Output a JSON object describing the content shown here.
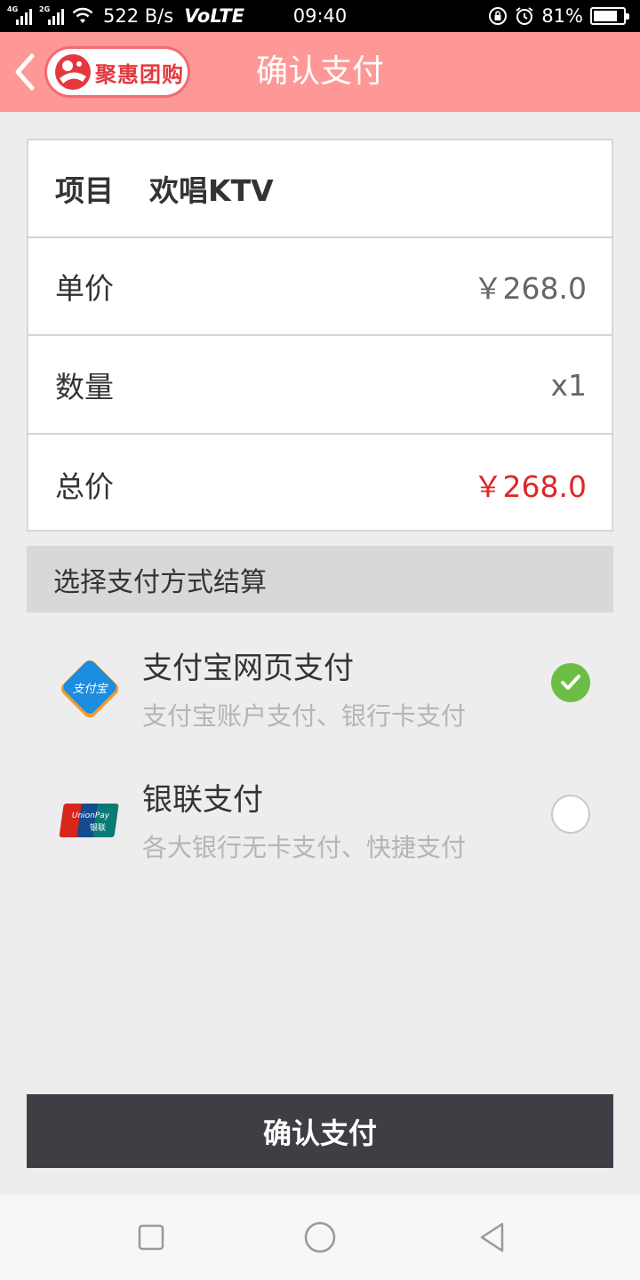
{
  "status_bar": {
    "network_1": "4G",
    "network_2": "2G",
    "speed": "522 B/s",
    "volte": "VoLTE",
    "time": "09:40",
    "battery": "81%",
    "battery_level": 0.81
  },
  "header": {
    "title": "确认支付",
    "logo_text": "聚惠团购"
  },
  "order": {
    "item_label": "项目",
    "item_value": "欢唱KTV",
    "unit_price_label": "单价",
    "unit_price_value": "￥268.0",
    "quantity_label": "数量",
    "quantity_value": "x1",
    "total_label": "总价",
    "total_value": "￥268.0"
  },
  "payment": {
    "section_title": "选择支付方式结算",
    "options": [
      {
        "name": "支付宝网页支付",
        "desc": "支付宝账户支付、银行卡支付",
        "selected": true,
        "icon": "alipay-icon",
        "icon_text": "支付宝"
      },
      {
        "name": "银联支付",
        "desc": "各大银行无卡支付、快捷支付",
        "selected": false,
        "icon": "unionpay-icon",
        "icon_text_1": "UnionPay",
        "icon_text_2": "银联"
      }
    ]
  },
  "confirm_button": "确认支付",
  "colors": {
    "header_bg": "#fd9896",
    "total_price": "#e02528",
    "selected_radio": "#6cbd45",
    "confirm_bg": "#3e3f44"
  }
}
